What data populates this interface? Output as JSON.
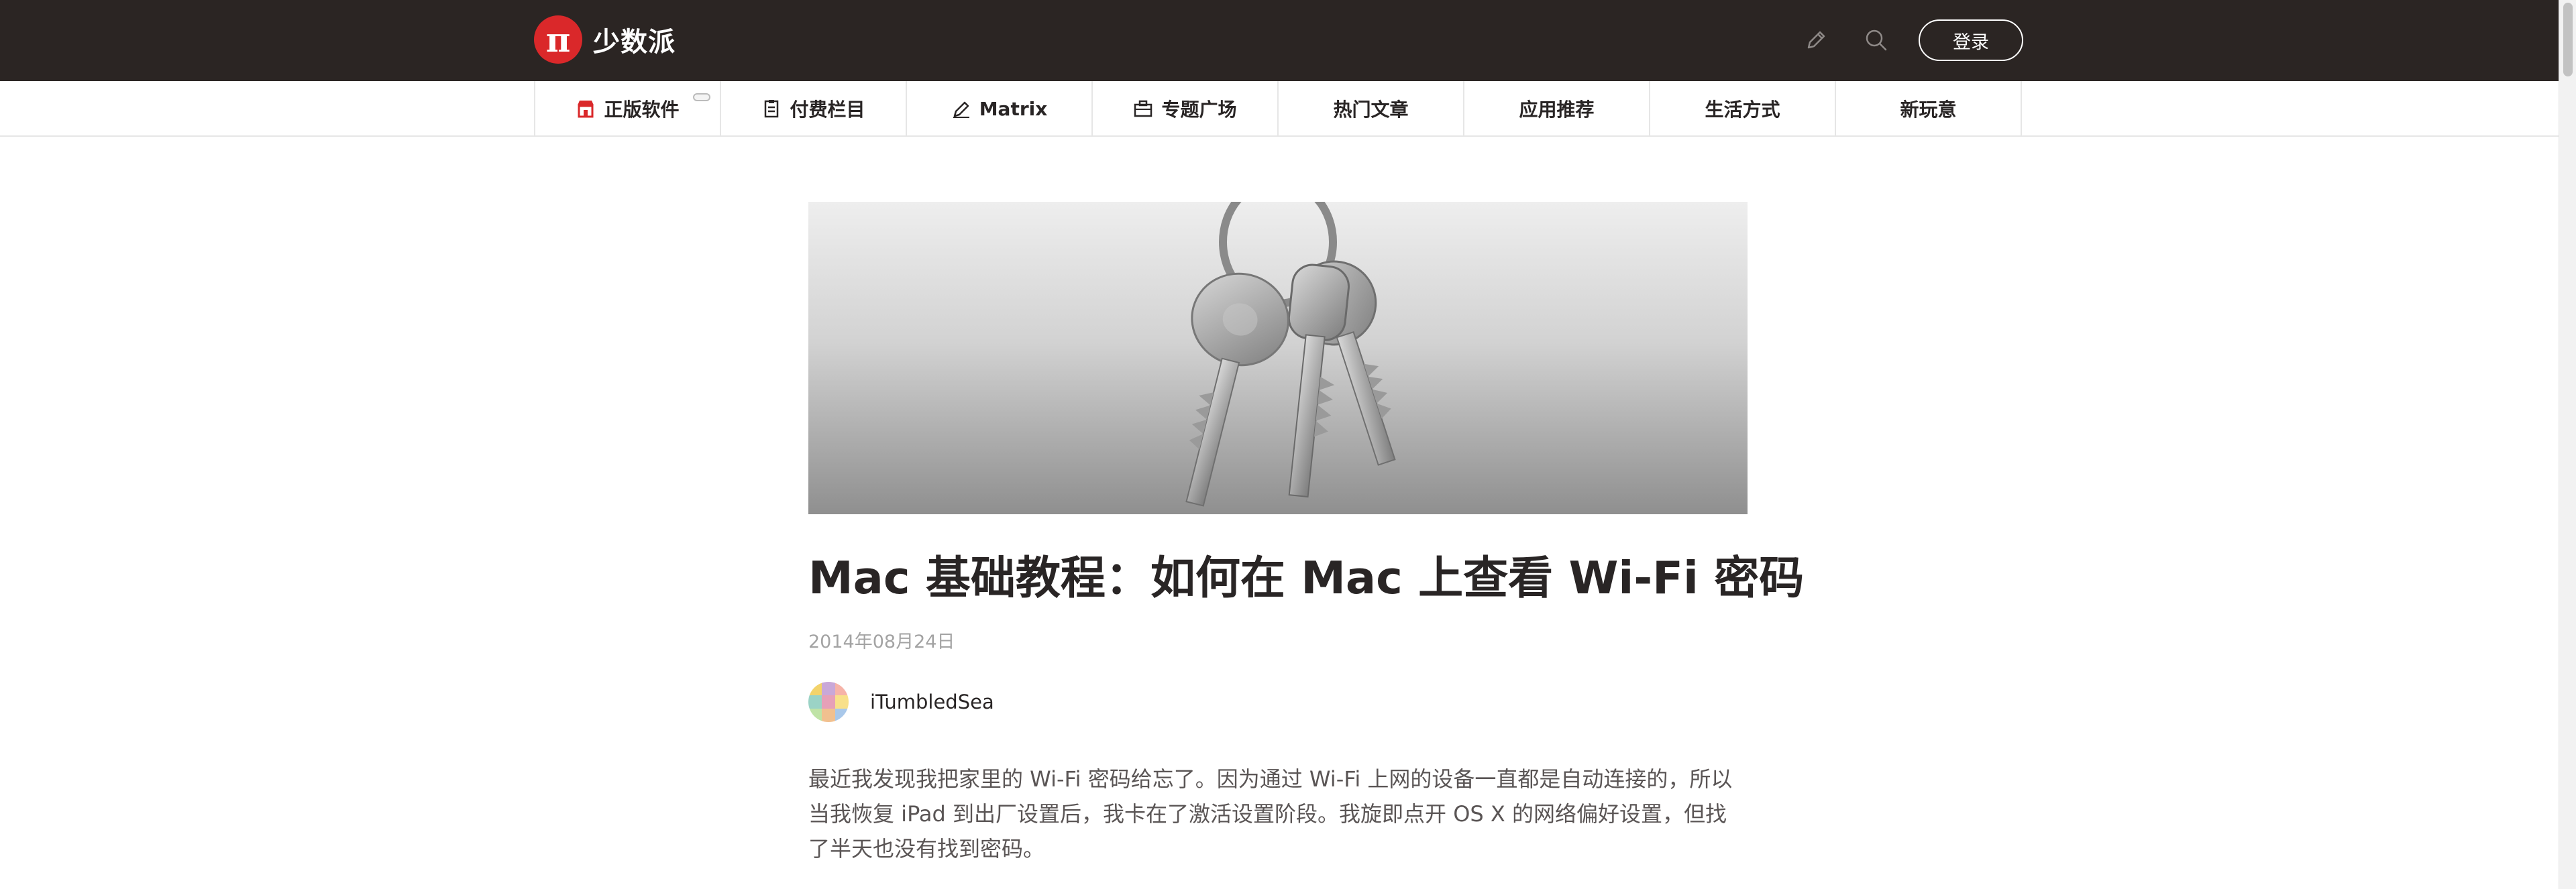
{
  "header": {
    "brand_name": "少数派",
    "brand_logo_glyph": "π",
    "login_label": "登录",
    "icons": [
      "pencil-icon",
      "search-icon"
    ]
  },
  "nav": {
    "items": [
      {
        "label": "正版软件",
        "icon": "store-icon"
      },
      {
        "label": "付费栏目",
        "icon": "clipboard-icon"
      },
      {
        "label": "Matrix",
        "icon": "pen-icon"
      },
      {
        "label": "专题广场",
        "icon": "briefcase-icon"
      },
      {
        "label": "热门文章"
      },
      {
        "label": "应用推荐"
      },
      {
        "label": "生活方式"
      },
      {
        "label": "新玩意"
      }
    ]
  },
  "article": {
    "title": "Mac 基础教程：如何在 Mac 上查看 Wi-Fi 密码",
    "date": "2014年08月24日",
    "author": "iTumbledSea",
    "paragraph": "最近我发现我把家里的 Wi-Fi 密码给忘了。因为通过 Wi-Fi 上网的设备一直都是自动连接的，所以当我恢复 iPad 到出厂设置后，我卡在了激活设置阶段。我旋即点开 OS X 的网络偏好设置，但找了半天也没有找到密码。"
  },
  "colors": {
    "header_bg": "#2b2523",
    "brand_red": "#da282a",
    "text": "#292525",
    "muted": "#a3a3a3"
  }
}
